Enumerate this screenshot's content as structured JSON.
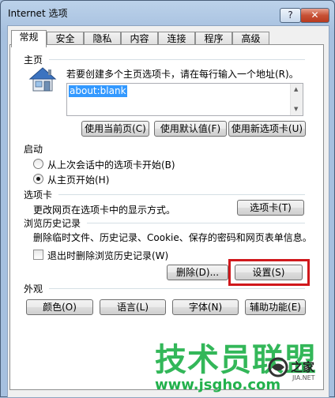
{
  "window": {
    "title": "Internet 选项",
    "help_label": "?",
    "close_label": "✕"
  },
  "tabs": [
    {
      "label": "常规",
      "active": true
    },
    {
      "label": "安全"
    },
    {
      "label": "隐私"
    },
    {
      "label": "内容"
    },
    {
      "label": "连接"
    },
    {
      "label": "程序"
    },
    {
      "label": "高级"
    }
  ],
  "home": {
    "title": "主页",
    "description": "若要创建多个主页选项卡，请在每行输入一个地址(R)。",
    "url": "about:blank",
    "buttons": {
      "use_current": "使用当前页(C)",
      "use_default": "使用默认值(F)",
      "use_new_tab": "使用新选项卡(U)"
    }
  },
  "startup": {
    "title": "启动",
    "options": [
      {
        "label": "从上次会话中的选项卡开始(B)",
        "selected": false
      },
      {
        "label": "从主页开始(H)",
        "selected": true
      }
    ]
  },
  "tabs_section": {
    "title": "选项卡",
    "description": "更改网页在选项卡中的显示方式。",
    "button": "选项卡(T)"
  },
  "history": {
    "title": "浏览历史记录",
    "description": "删除临时文件、历史记录、Cookie、保存的密码和网页表单信息。",
    "checkbox_label": "退出时删除浏览历史记录(W)",
    "checkbox_checked": false,
    "delete_button": "删除(D)...",
    "settings_button": "设置(S)"
  },
  "appearance": {
    "title": "外观",
    "buttons": {
      "colors": "颜色(O)",
      "languages": "语言(L)",
      "fonts": "字体(N)",
      "accessibility": "辅助功能(E)"
    }
  },
  "watermark": {
    "main": "技术员联盟",
    "url": "www.jsgho.com",
    "side": "之家",
    "side_small": "JIA.NET"
  },
  "colors": {
    "highlight": "#d0181c",
    "selection": "#3399ff",
    "watermark": "#22b14c"
  }
}
